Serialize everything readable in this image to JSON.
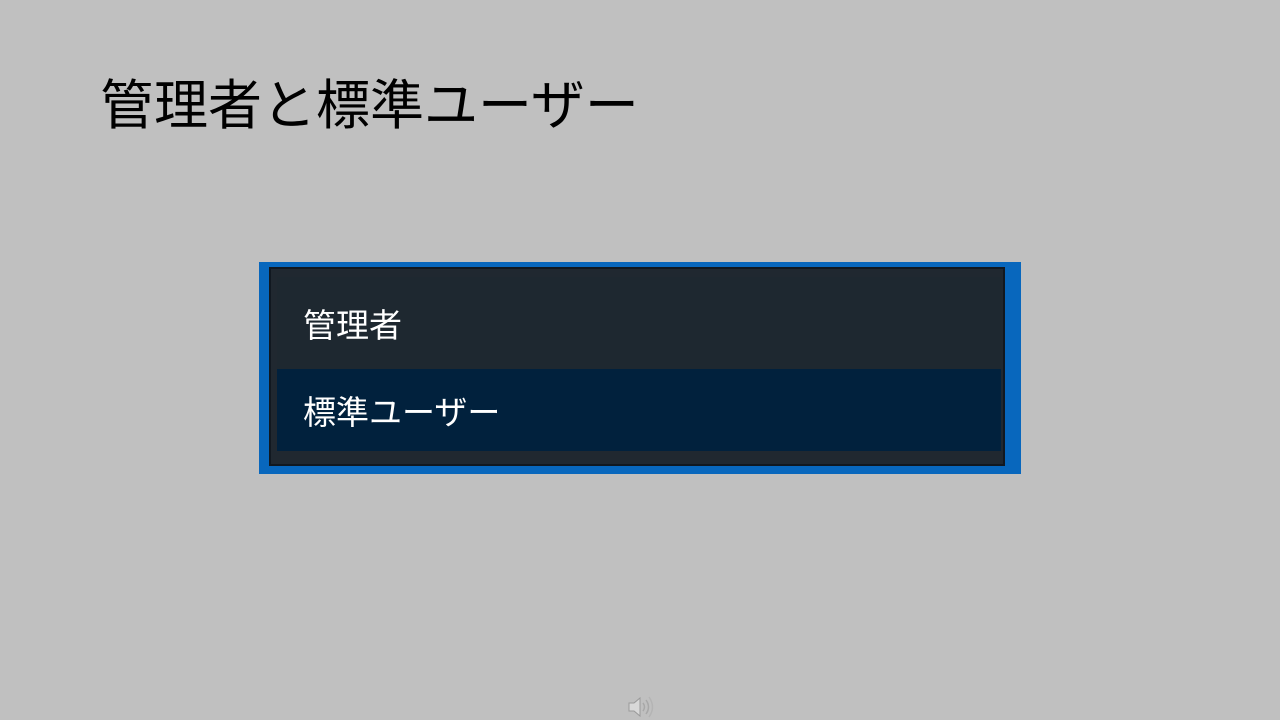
{
  "slide": {
    "title": "管理者と標準ユーザー"
  },
  "dropdown": {
    "options": [
      {
        "label": "管理者",
        "selected": false
      },
      {
        "label": "標準ユーザー",
        "selected": true
      }
    ]
  },
  "colors": {
    "background": "#c0c0c0",
    "frame_accent": "#0867bd",
    "list_background": "#202830",
    "selected_background": "#01213d"
  },
  "icons": {
    "audio": "speaker-icon"
  }
}
